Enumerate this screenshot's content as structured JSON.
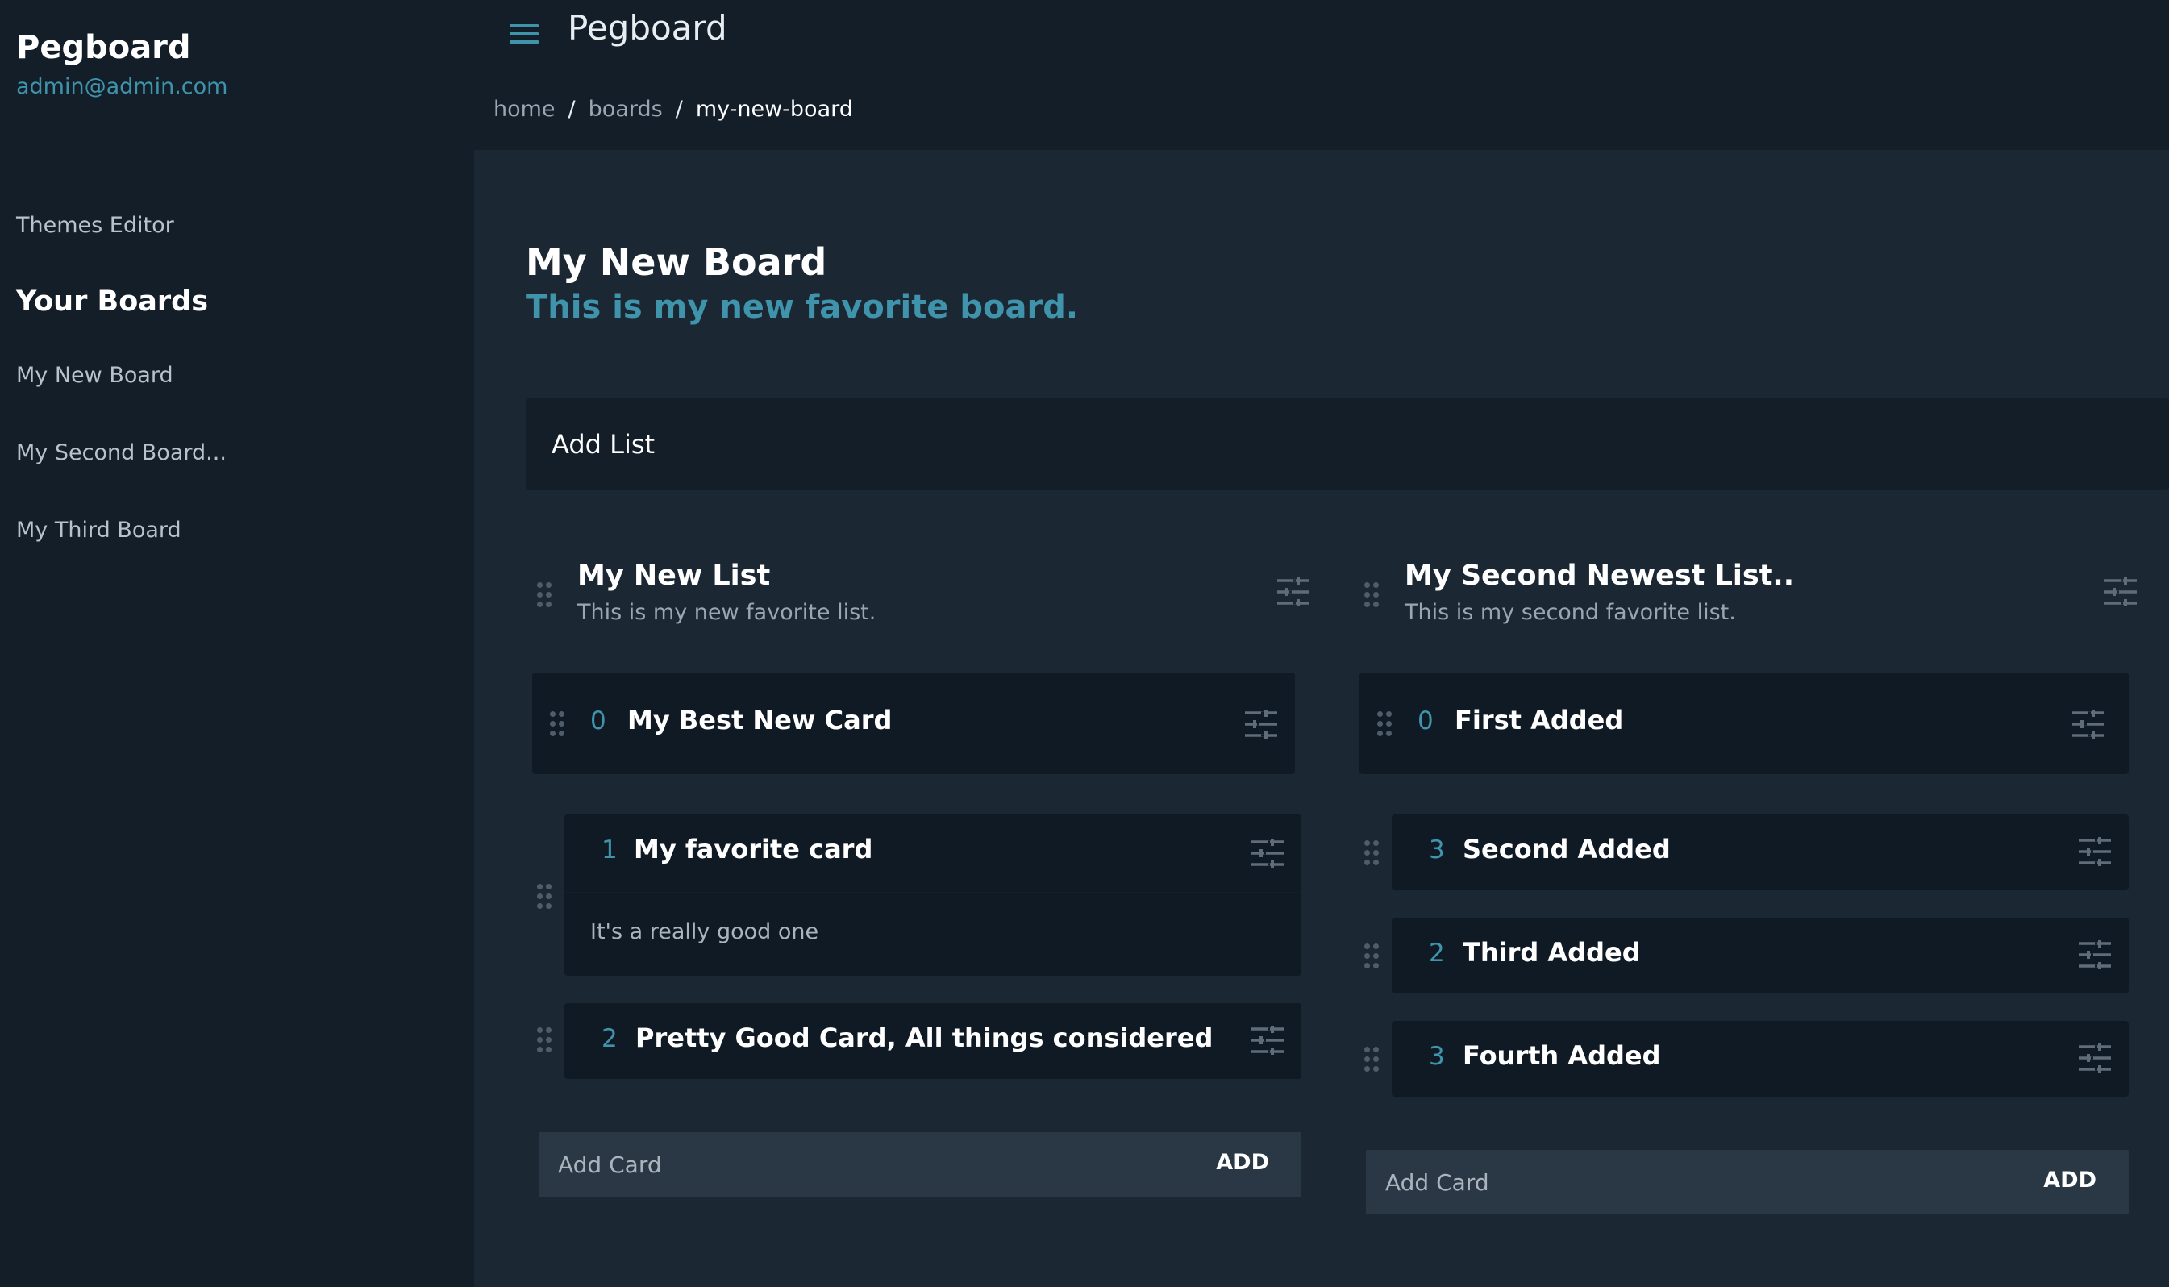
{
  "app": {
    "name": "Pegboard",
    "user_email": "admin@admin.com"
  },
  "sidebar": {
    "themes_editor": "Themes Editor",
    "boards_heading": "Your Boards",
    "boards": [
      "My New Board",
      "My Second Board...",
      "My Third Board"
    ]
  },
  "header": {
    "title": "Pegboard",
    "breadcrumb": {
      "home": "home",
      "boards": "boards",
      "current": "my-new-board",
      "separator": "/"
    }
  },
  "board": {
    "title": "My New Board",
    "description": "This is my new favorite board.",
    "add_list_label": "Add List"
  },
  "lists": [
    {
      "title": "My New List",
      "description": "This is my new favorite list.",
      "header_card": {
        "num": "0",
        "title": "My Best New Card"
      },
      "cards": [
        {
          "num": "1",
          "title": "My favorite card",
          "body": "It's a really good one"
        },
        {
          "num": "2",
          "title": "Pretty Good Card, All things considered"
        }
      ],
      "add_card": {
        "placeholder": "Add Card",
        "button": "ADD"
      }
    },
    {
      "title": "My Second Newest List..",
      "description": "This is my second favorite list.",
      "header_card": {
        "num": "0",
        "title": "First Added"
      },
      "cards": [
        {
          "num": "3",
          "title": "Second Added"
        },
        {
          "num": "2",
          "title": "Third Added"
        },
        {
          "num": "3",
          "title": "Fourth Added"
        }
      ],
      "add_card": {
        "placeholder": "Add Card",
        "button": "ADD"
      }
    }
  ],
  "icons": {
    "menu": "menu-icon",
    "drag": "drag-handle-icon",
    "settings": "tune-icon"
  },
  "colors": {
    "accent": "#3f94ac",
    "sidebar_bg": "#131e29",
    "main_bg": "#1b2733",
    "card_bg": "#101a25"
  }
}
